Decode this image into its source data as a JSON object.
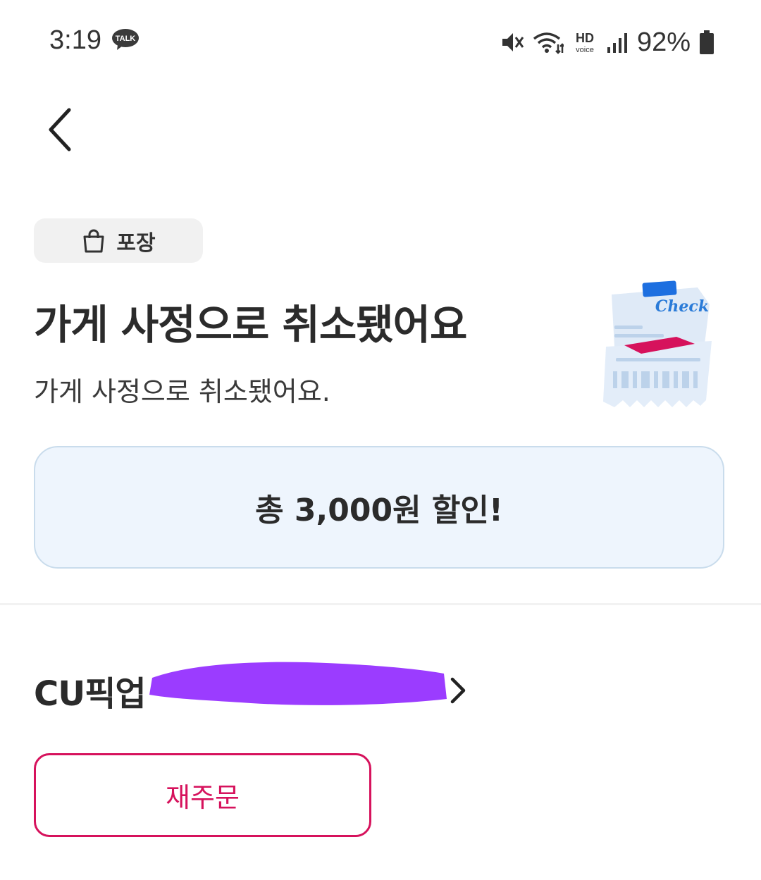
{
  "status_bar": {
    "time": "3:19",
    "notification_badge": "TALK",
    "hd_label": "HD",
    "voice_label": "voice",
    "battery_percent": "92%",
    "icons": [
      "talk-icon",
      "mute-icon",
      "wifi-icon",
      "hd-voice-icon",
      "signal-icon",
      "battery-icon"
    ]
  },
  "header": {
    "back_icon": "chevron-left-icon"
  },
  "order": {
    "type_icon": "shopping-bag-icon",
    "type_label": "포장",
    "title": "가게 사정으로 취소됐어요",
    "subtitle": "가게 사정으로 취소됐어요.",
    "illustration_text": "Check"
  },
  "discount": {
    "text": "총 3,000원 할인!"
  },
  "store": {
    "name": "CU픽업 ",
    "chevron_icon": "chevron-right-icon"
  },
  "actions": {
    "reorder_label": "재주문"
  },
  "colors": {
    "accent": "#d6125c",
    "discount_bg": "#eef5fd",
    "discount_border": "#c9dcec",
    "chip_bg": "#f1f1f1",
    "redaction": "#9b3cff"
  }
}
